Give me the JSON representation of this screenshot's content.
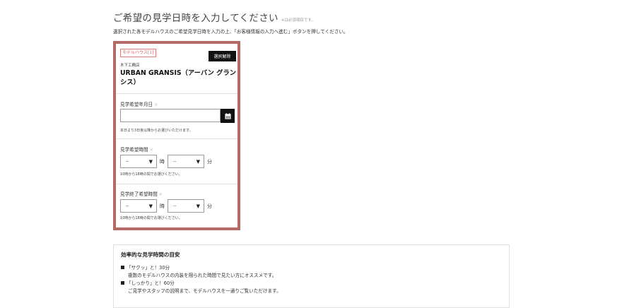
{
  "header": {
    "title": "ご希望の見学日時を入力してください",
    "required_note": "※は必須項目です。",
    "instruction": "選択された各モデルハウスのご希望見学日時を入力の上、「お客様情報の入力へ進む」ボタンを押してください。"
  },
  "card": {
    "tag": "モデルハウス[1]",
    "deselect_label": "選択解除",
    "prefecture": "木下工務店",
    "house_name": "URBAN GRANSIS（アーバン グランシス）",
    "date_field": {
      "label": "見学希望年月日",
      "required_mark": "※",
      "value": "",
      "hint": "本日より3日後以降からお選びいただけます。"
    },
    "start_time": {
      "label": "見学希望時間",
      "required_mark": "※",
      "hour_value": "--",
      "minute_value": "--",
      "hour_unit": "時",
      "minute_unit": "分",
      "hint": "10時から18時の間でお選びください。"
    },
    "end_time": {
      "label": "見学終了希望時間",
      "required_mark": "※",
      "hour_value": "--",
      "minute_value": "--",
      "hour_unit": "時",
      "minute_unit": "分",
      "hint": "10時から18時の間でお選びください。"
    }
  },
  "guide": {
    "title": "効率的な見学時間の目安",
    "items": [
      {
        "label": "「サクッ」と！30分",
        "desc": "複数のモデルハウスの内装を限られた時間で見たい方にオススメです。"
      },
      {
        "label": "「しっかり」と！60分",
        "desc": "ご見学やスタッフの説明まで、モデルハウスを一通りご覧いただけます。"
      }
    ]
  },
  "colors": {
    "card_border": "#b46a66",
    "tag_text": "#d9645c",
    "button_bg": "#111111"
  }
}
